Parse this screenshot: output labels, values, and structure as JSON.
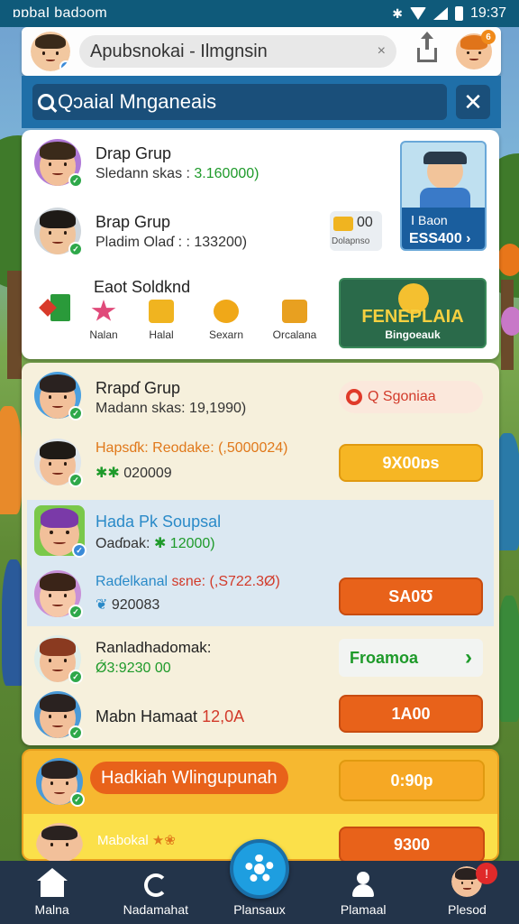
{
  "status_bar": {
    "left_text": "ɒɒbaI badɔom",
    "time": "19:37"
  },
  "app_bar": {
    "title": "Apubsnokai - Ilmgnsin",
    "close_glyph": "×",
    "notif_count": "6"
  },
  "search": {
    "value": "Qɔaial Mnganeais",
    "close_glyph": "✕"
  },
  "card1": {
    "row1": {
      "name": "Drap Grup",
      "sub": "Sledann skas : ",
      "value": "3.160000)"
    },
    "row2": {
      "name": "Brap Grup",
      "sub": "Pladim Olaɗ : : 133200)"
    },
    "chip": {
      "count": "00",
      "label": "Dolapnso"
    },
    "promo": {
      "line1": "Ⅰ Baon",
      "line2": "ESS400 ›"
    },
    "feature_title": "Eaot Soldknd",
    "categories": [
      {
        "label": "Nalan"
      },
      {
        "label": "Halal"
      },
      {
        "label": "Sexarn"
      },
      {
        "label": "Orcalana"
      }
    ],
    "banner": {
      "line1": "FENEPLAIA",
      "line2": "Bingoeauk"
    }
  },
  "card2": {
    "row1": {
      "name": "Rrapɗ Grup",
      "sub": "Madann skas: 19,1990)",
      "pill": "Q Sgoniaa"
    },
    "row2": {
      "name": "Hapsɗk: Reodake: (,5000024)",
      "sub": "020009",
      "button": "9X00ɒs"
    },
    "row3": {
      "name": "Hada Pk Soupsal",
      "sub": "Oaɗɒak: ",
      "value": "12000)"
    },
    "row4": {
      "name": "Raɗelkanal",
      "name2": "sɛne: (,S722.3Ø)",
      "sub": "920083",
      "button": "SA0Ʊ"
    },
    "row5": {
      "name": "Ranladhadomak:",
      "sub": "Ǿ3:9230 00",
      "pill": "Froamoa"
    },
    "row6": {
      "name": "Mabn Hamaat ",
      "value": "12,0A",
      "button": "1A00"
    }
  },
  "card3": {
    "row1": {
      "name": "Hadkiah Wlingupunah",
      "button": "0:90p"
    },
    "row2": {
      "name": "Mabokal",
      "button": "9300"
    }
  },
  "bottom_nav": [
    {
      "label": "Malna"
    },
    {
      "label": "Nadamahat"
    },
    {
      "label": "Plansaux"
    },
    {
      "label": "Plamaal"
    },
    {
      "label": "Plesod"
    }
  ],
  "bottom_nav_badge": "!",
  "colors": {
    "accent": "#1f6fa8",
    "orange": "#e8621a",
    "yellow": "#f6b624",
    "green": "#1e9a2a"
  }
}
